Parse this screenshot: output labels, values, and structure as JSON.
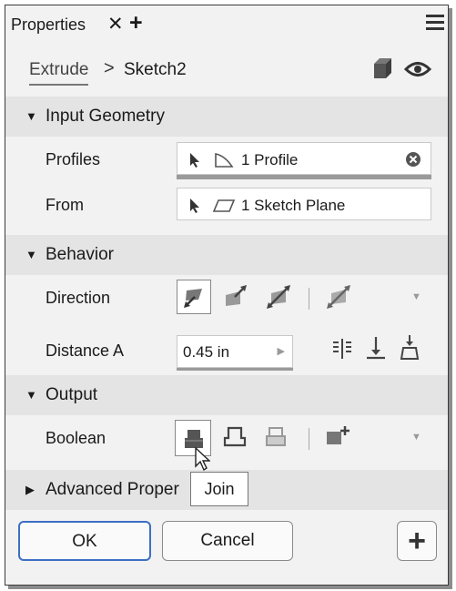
{
  "window": {
    "tab_label": "Properties",
    "close_glyph": "✕",
    "add_glyph": "+"
  },
  "breadcrumb": {
    "parent": "Extrude",
    "separator": ">",
    "current": "Sketch2"
  },
  "input_geometry": {
    "header": "Input Geometry",
    "profiles_label": "Profiles",
    "profiles_value": "1 Profile",
    "from_label": "From",
    "from_value": "1 Sketch Plane"
  },
  "behavior": {
    "header": "Behavior",
    "direction_label": "Direction",
    "distance_label": "Distance A",
    "distance_value": "0.45 in"
  },
  "output": {
    "header": "Output",
    "boolean_label": "Boolean",
    "tooltip": "Join"
  },
  "advanced": {
    "header": "Advanced Proper"
  },
  "buttons": {
    "ok": "OK",
    "cancel": "Cancel",
    "add": "+"
  },
  "icons": [
    "menu-icon",
    "cube-icon",
    "eye-icon",
    "cursor-icon",
    "profile-icon",
    "plane-icon",
    "clear-icon",
    "direction-default-icon",
    "direction-flip-icon",
    "direction-symmetric-icon",
    "direction-asymmetric-icon",
    "dropdown-arrow-icon",
    "distance-extents-icon",
    "distance-to-icon",
    "distance-taper-icon",
    "join-icon",
    "cut-icon",
    "intersect-icon",
    "new-solid-icon",
    "mouse-pointer-icon"
  ],
  "colors": {
    "accent": "#3c6fc4",
    "header_bg": "#e4e4e4",
    "panel_bg": "#f2f2f2"
  }
}
